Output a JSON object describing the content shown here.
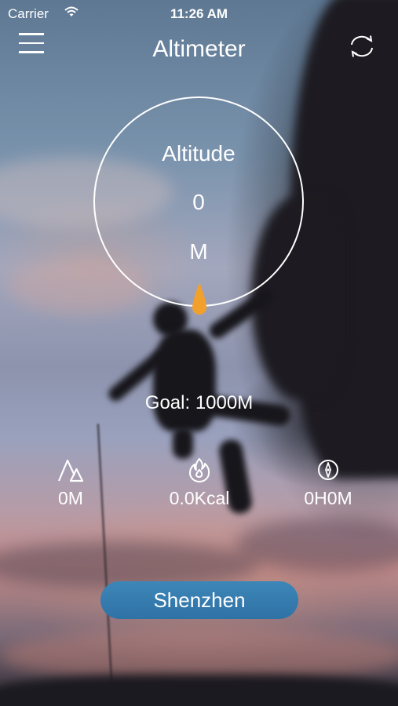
{
  "status_bar": {
    "carrier": "Carrier",
    "time": "11:26 AM"
  },
  "header": {
    "title": "Altimeter",
    "menu_icon": "hamburger-menu-icon",
    "refresh_icon": "refresh-icon"
  },
  "dial": {
    "label": "Altitude",
    "value": "0",
    "unit": "M",
    "marker_color": "#f2a02c"
  },
  "goal": {
    "text": "Goal: 1000M"
  },
  "stats": [
    {
      "icon": "mountain-icon",
      "value": "0M"
    },
    {
      "icon": "flame-icon",
      "value": "0.0Kcal"
    },
    {
      "icon": "compass-icon",
      "value": "0H0M"
    }
  ],
  "location": {
    "city": "Shenzhen",
    "button_color": "#3479ad"
  }
}
